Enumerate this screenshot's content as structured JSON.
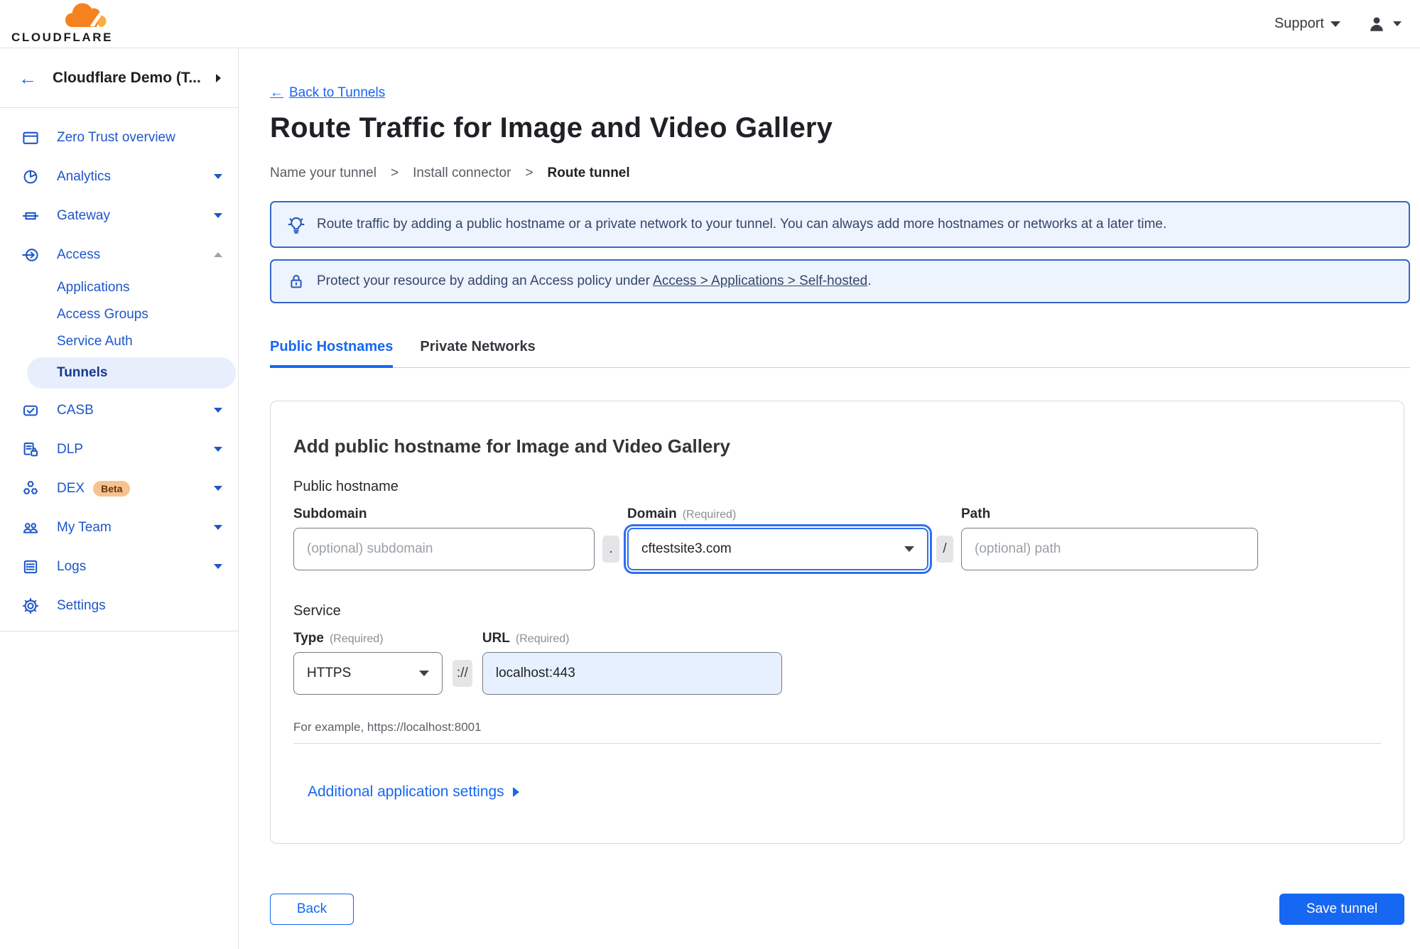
{
  "colors": {
    "accent_blue": "#1667f2",
    "nav_blue": "#1e56c8",
    "selected_pill_bg": "#e7eefc",
    "banner_bg": "#edf4fd",
    "banner_border": "#3566c6",
    "url_filled_bg": "#e7f0fe",
    "beta_badge_bg": "#f8c18d",
    "logo_orange": "#f6821f",
    "logo_light_orange": "#fbad41"
  },
  "icons": {
    "back_arrow": "←"
  },
  "topbar": {
    "brand": "CLOUDFLARE",
    "support_label": "Support"
  },
  "sidebar": {
    "account_label": "Cloudflare Demo (T...",
    "items": [
      {
        "label": "Zero Trust overview"
      },
      {
        "label": "Analytics"
      },
      {
        "label": "Gateway"
      },
      {
        "label": "Access"
      },
      {
        "label": "CASB"
      },
      {
        "label": "DLP"
      },
      {
        "label": "DEX",
        "badge": "Beta"
      },
      {
        "label": "My Team"
      },
      {
        "label": "Logs"
      },
      {
        "label": "Settings"
      }
    ],
    "access_children": [
      "Applications",
      "Access Groups",
      "Service Auth",
      "Tunnels"
    ],
    "selected_item": "Tunnels"
  },
  "header": {
    "back_label": "Back to Tunnels",
    "title": "Route Traffic for Image and Video Gallery",
    "steps": [
      "Name your tunnel",
      "Install connector",
      "Route tunnel"
    ],
    "step_separator": ">",
    "current_step": "Route tunnel"
  },
  "banners": [
    {
      "icon": "lightbulb-icon",
      "text": "Route traffic by adding a public hostname or a private network to your tunnel. You can always add more hostnames or networks at a later time."
    },
    {
      "icon": "lock-icon",
      "prefix": "Protect your resource by adding an Access policy under",
      "link_label": "Access > Applications > Self-hosted",
      "suffix": "."
    }
  ],
  "tabs": [
    {
      "label": "Public Hostnames",
      "active": true
    },
    {
      "label": "Private Networks",
      "active": false
    }
  ],
  "form": {
    "card_title": "Add public hostname for Image and Video Gallery",
    "public_hostname_section": "Public hostname",
    "subdomain": {
      "label": "Subdomain",
      "placeholder": "(optional) subdomain",
      "value": ""
    },
    "domain": {
      "label": "Domain",
      "required": "(Required)",
      "value": "cftestsite3.com"
    },
    "path": {
      "label": "Path",
      "placeholder": "(optional) path",
      "value": ""
    },
    "separators": {
      "dot": ".",
      "slash": "/",
      "scheme": "://"
    },
    "service_section": "Service",
    "type": {
      "label": "Type",
      "required": "(Required)",
      "value": "HTTPS"
    },
    "url": {
      "label": "URL",
      "required": "(Required)",
      "value": "localhost:443"
    },
    "example": "For example, https://localhost:8001",
    "additional_settings_label": "Additional application settings"
  },
  "footer": {
    "back_label": "Back",
    "save_label": "Save tunnel"
  }
}
